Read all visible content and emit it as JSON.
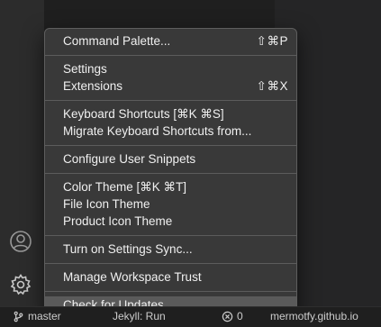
{
  "activity_bar": {
    "accounts_icon": "account-icon",
    "manage_icon": "gear-icon"
  },
  "menu": {
    "items": [
      {
        "label": "Command Palette...",
        "shortcut": "⇧⌘P"
      },
      {
        "label": "Settings",
        "shortcut": ""
      },
      {
        "label": "Extensions",
        "shortcut": "⇧⌘X"
      },
      {
        "label": "Keyboard Shortcuts [⌘K ⌘S]",
        "shortcut": ""
      },
      {
        "label": "Migrate Keyboard Shortcuts from...",
        "shortcut": ""
      },
      {
        "label": "Configure User Snippets",
        "shortcut": ""
      },
      {
        "label": "Color Theme [⌘K ⌘T]",
        "shortcut": ""
      },
      {
        "label": "File Icon Theme",
        "shortcut": ""
      },
      {
        "label": "Product Icon Theme",
        "shortcut": ""
      },
      {
        "label": "Turn on Settings Sync...",
        "shortcut": ""
      },
      {
        "label": "Manage Workspace Trust",
        "shortcut": ""
      },
      {
        "label": "Check for Updates...",
        "shortcut": ""
      }
    ],
    "active_item": "Check for Updates..."
  },
  "statusbar": {
    "branch": "master",
    "jekyll": "Jekyll: Run",
    "problems": "0",
    "site": "mermotfy.github.io"
  }
}
